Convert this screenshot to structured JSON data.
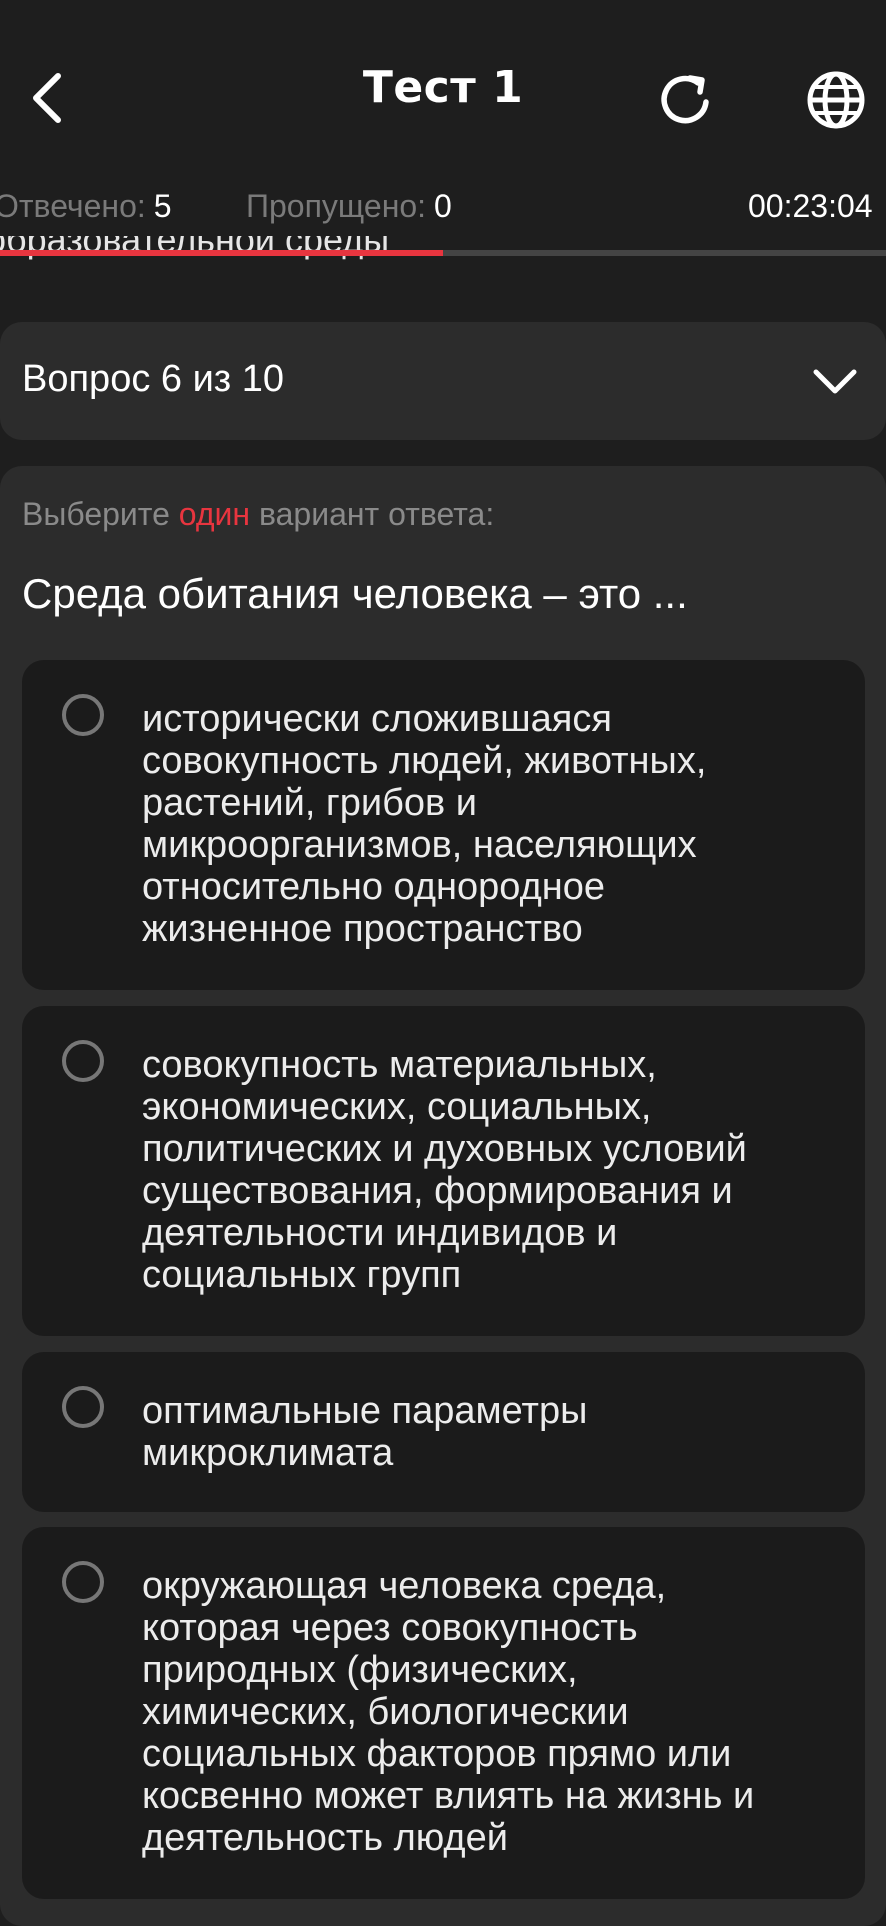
{
  "header": {
    "title": "Тест 1",
    "back_icon": "chevron-left-icon",
    "reload_icon": "reload-icon",
    "language_icon": "globe-icon"
  },
  "stats": {
    "answered_label": "Отвечено:",
    "answered_value": "5",
    "skipped_label": "Пропущено:",
    "skipped_value": "0",
    "timer": "00:23:04"
  },
  "progress": {
    "fraction": 0.5,
    "fill_color": "#e8353f",
    "track_color": "#444444"
  },
  "peek_text": "образовательной среды",
  "question_nav": {
    "label": "Вопрос 6 из 10",
    "icon": "chevron-down-icon"
  },
  "question": {
    "hint_before": "Выберите ",
    "hint_accent": "один",
    "hint_after": " вариант ответа:",
    "text": "Среда обитания человека – это ...",
    "options": [
      {
        "text": "исторически сложившаяся\nсовокупность людей, животных,\nрастений, грибов и\nмикроорганизмов, населяющих\nотносительно однородное\nжизненное пространство"
      },
      {
        "text": "совокупность материальных,\nэкономических, социальных,\nполитических и духовных условий\nсуществования, формирования и\nдеятельности индивидов и\nсоциальных групп"
      },
      {
        "text": "оптимальные параметры\nмикроклимата"
      },
      {
        "text": "окружающая человека среда,\nкоторая через совокупность\nприродных (физических,\nхимических, биологическии\nсоциальных факторов прямо или\nкосвенно может влиять на жизнь и\nдеятельность людей"
      }
    ]
  },
  "colors": {
    "background": "#1e1e1e",
    "card": "#2c2c2c",
    "option": "#1b1b1b",
    "accent": "#e8353f"
  }
}
